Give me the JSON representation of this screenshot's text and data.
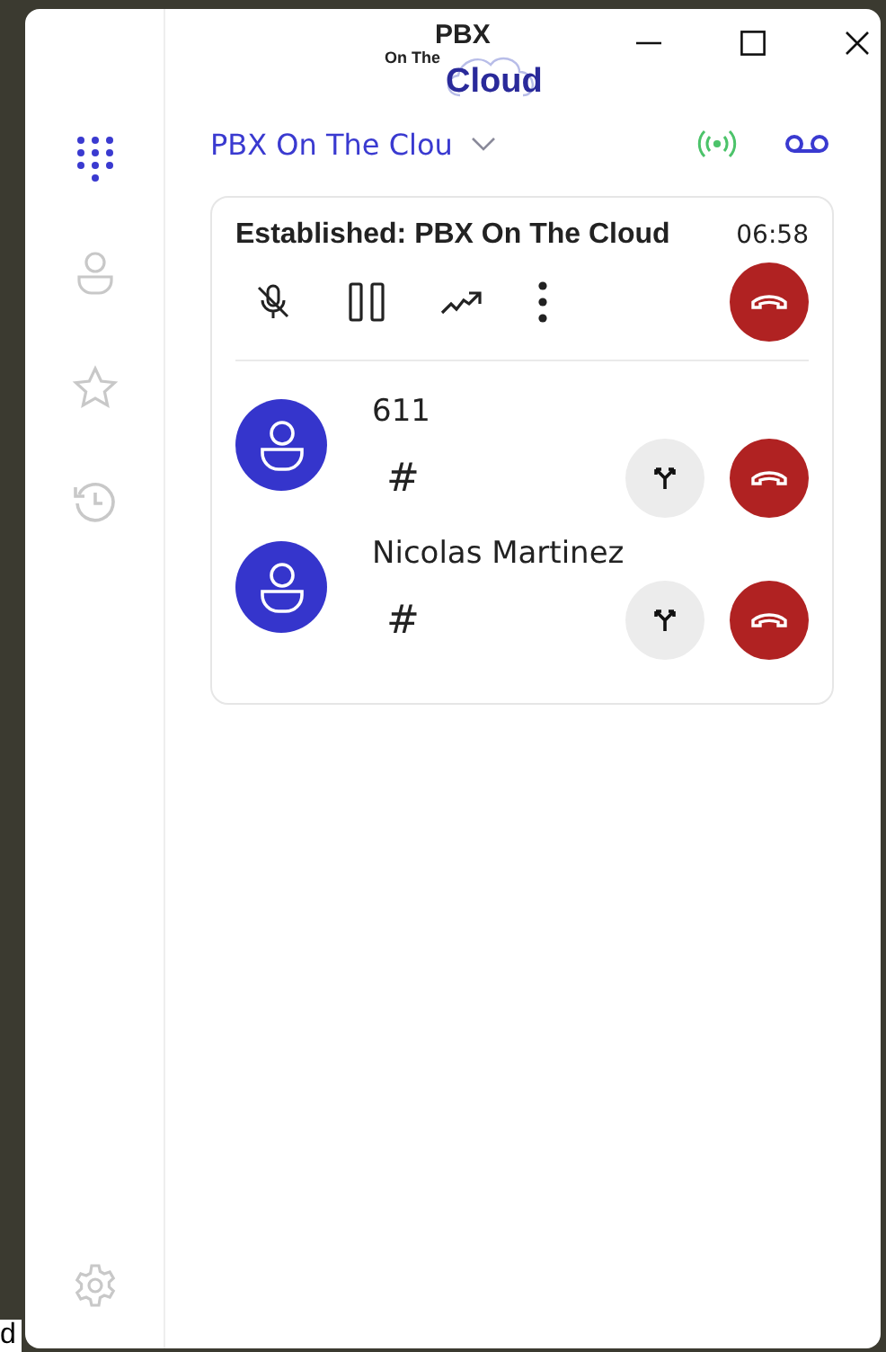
{
  "background_text": "d",
  "logo": {
    "line_1": "PBX",
    "line_2": "On The",
    "line_3": "Cloud"
  },
  "sidebar": {
    "items": [
      {
        "kind": "dialpad",
        "selected": true
      },
      {
        "kind": "contacts",
        "selected": false
      },
      {
        "kind": "favorites",
        "selected": false
      },
      {
        "kind": "history",
        "selected": false
      }
    ]
  },
  "account": {
    "name": "PBX On The Clou",
    "registered": true
  },
  "call": {
    "status": "Established: PBX On The Cloud",
    "duration": "06:58",
    "muted": true,
    "participants": [
      {
        "name": "611",
        "dialpad_label": "#"
      },
      {
        "name": "Nicolas Martinez",
        "dialpad_label": "#"
      }
    ]
  }
}
